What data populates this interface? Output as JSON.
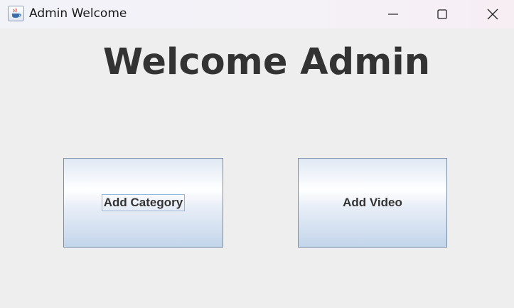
{
  "window": {
    "title": "Admin Welcome",
    "icon": "java-cup-icon",
    "controls": [
      "minimize-icon",
      "maximize-icon",
      "close-icon"
    ]
  },
  "main": {
    "heading": "Welcome Admin",
    "buttons": {
      "add_category": "Add Category",
      "add_video": "Add Video"
    },
    "focused_button": "add_category"
  },
  "colors": {
    "background": "#eeeeee",
    "heading_text": "#333333",
    "button_border": "#7a8ea8",
    "button_gradient_bottom": "#c3d5ea"
  }
}
